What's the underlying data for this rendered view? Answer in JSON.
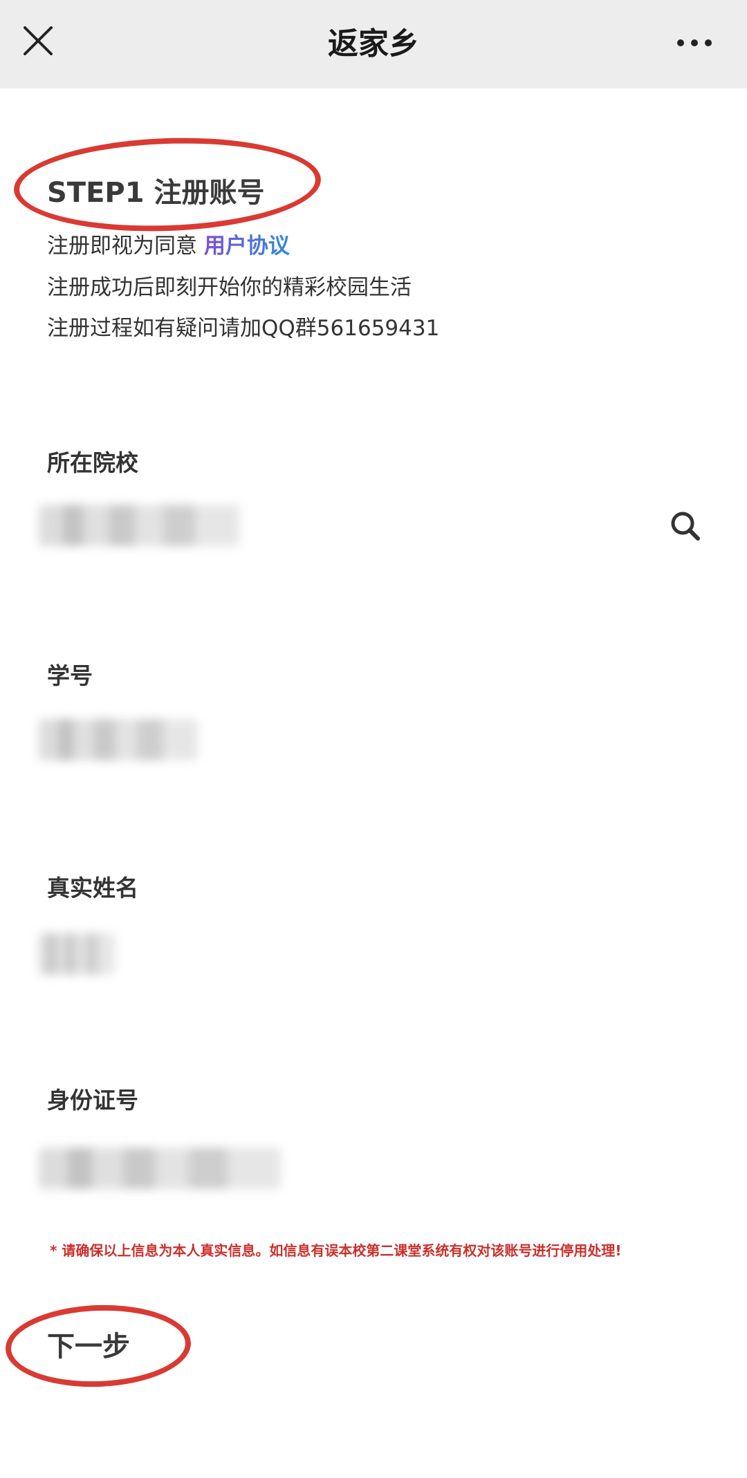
{
  "header": {
    "title": "返家乡",
    "close_icon": "close-icon",
    "more_icon": "more-icon"
  },
  "step": {
    "title": "STEP1 注册账号",
    "agree_prefix": "注册即视为同意 ",
    "agreement_link": "用户协议",
    "line2": "注册成功后即刻开始你的精彩校园生活",
    "line3": "注册过程如有疑问请加QQ群561659431"
  },
  "form": {
    "school_label": "所在院校",
    "student_id_label": "学号",
    "real_name_label": "真实姓名",
    "id_card_label": "身份证号",
    "search_icon": "search-icon"
  },
  "warning": "* 请确保以上信息为本人真实信息。如信息有误本校第二课堂系统有权对该账号进行停用处理!",
  "actions": {
    "next_label": "下一步"
  },
  "colors": {
    "header_bg": "#ededed",
    "annotation_red": "#d93a32",
    "warning_red": "#c9302c",
    "link_gradient_start": "#7a4fd6",
    "link_gradient_end": "#2f8bdc"
  }
}
